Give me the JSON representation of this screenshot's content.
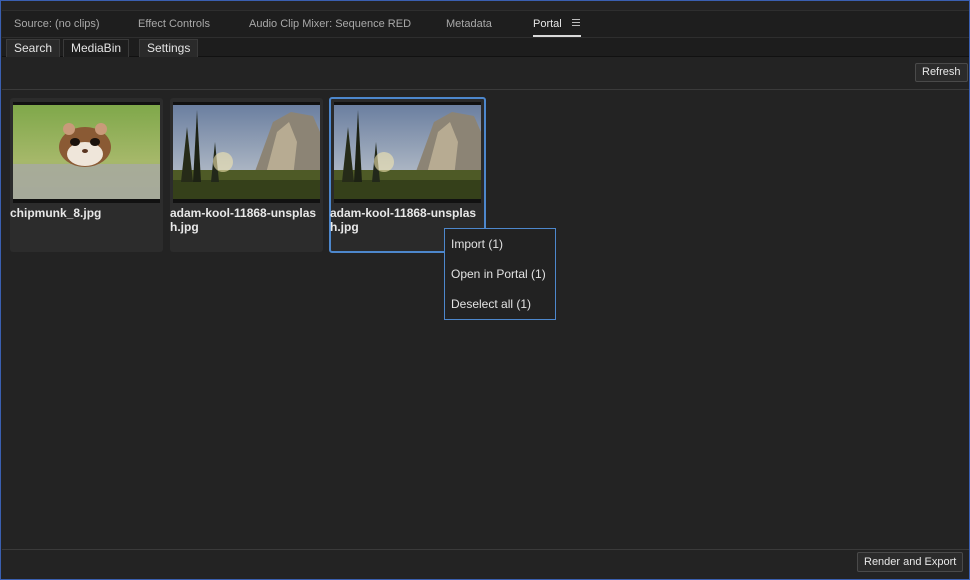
{
  "top_tabs": [
    {
      "label": "Source: (no clips)"
    },
    {
      "label": "Effect Controls"
    },
    {
      "label": "Audio Clip Mixer: Sequence RED"
    },
    {
      "label": "Metadata"
    },
    {
      "label": "Portal",
      "active": true
    }
  ],
  "sub_tabs": [
    {
      "label": "Search"
    },
    {
      "label": "MediaBin",
      "active": true
    },
    {
      "label": "Settings"
    }
  ],
  "toolbar": {
    "refresh_label": "Refresh"
  },
  "media_items": [
    {
      "filename": "chipmunk_8.jpg",
      "selected": false
    },
    {
      "filename": "adam-kool-11868-unsplash.jpg",
      "selected": false
    },
    {
      "filename": "adam-kool-11868-unsplash.jpg",
      "selected": true
    }
  ],
  "context_menu": {
    "items": [
      {
        "label": "Import (1)"
      },
      {
        "label": "Open in Portal (1)"
      },
      {
        "label": "Deselect all (1)"
      }
    ]
  },
  "footer": {
    "render_label": "Render and Export"
  },
  "colors": {
    "accent": "#4d87cc",
    "background": "#232323"
  }
}
